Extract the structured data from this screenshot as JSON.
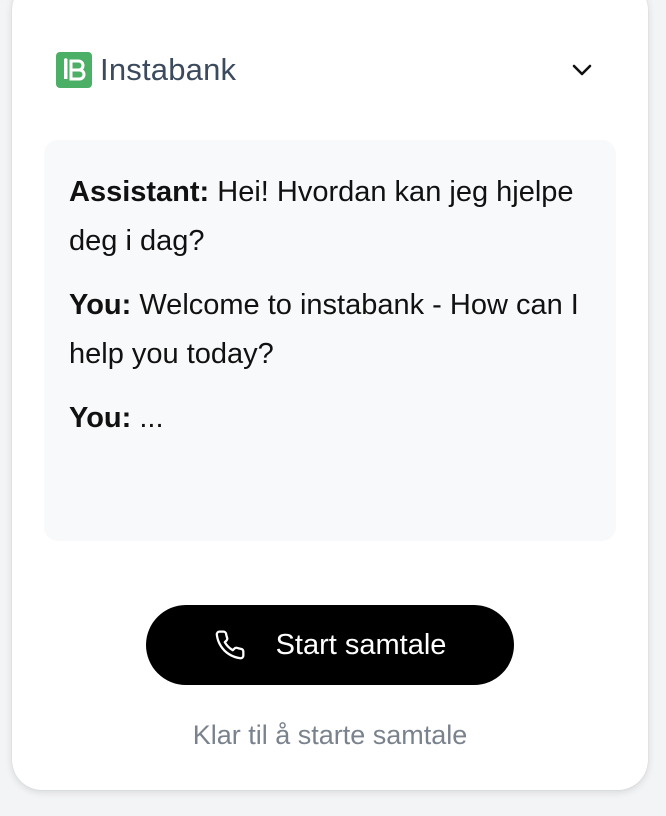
{
  "brand": {
    "name": "Instabank",
    "logo_mark_text": "iB",
    "accent_color": "#4caf66",
    "text_color": "#3c4a5e"
  },
  "header": {
    "collapse_icon": "chevron-down-icon"
  },
  "transcript": {
    "messages": [
      {
        "speaker": "Assistant:",
        "text": " Hei! Hvordan kan jeg hjelpe deg i dag?"
      },
      {
        "speaker": "You:",
        "text": " Welcome to instabank - How can I help you today?"
      },
      {
        "speaker": "You:",
        "text": " ..."
      }
    ]
  },
  "call": {
    "label": "Start samtale",
    "icon": "phone-icon"
  },
  "status": {
    "text": "Klar til å starte samtale"
  }
}
